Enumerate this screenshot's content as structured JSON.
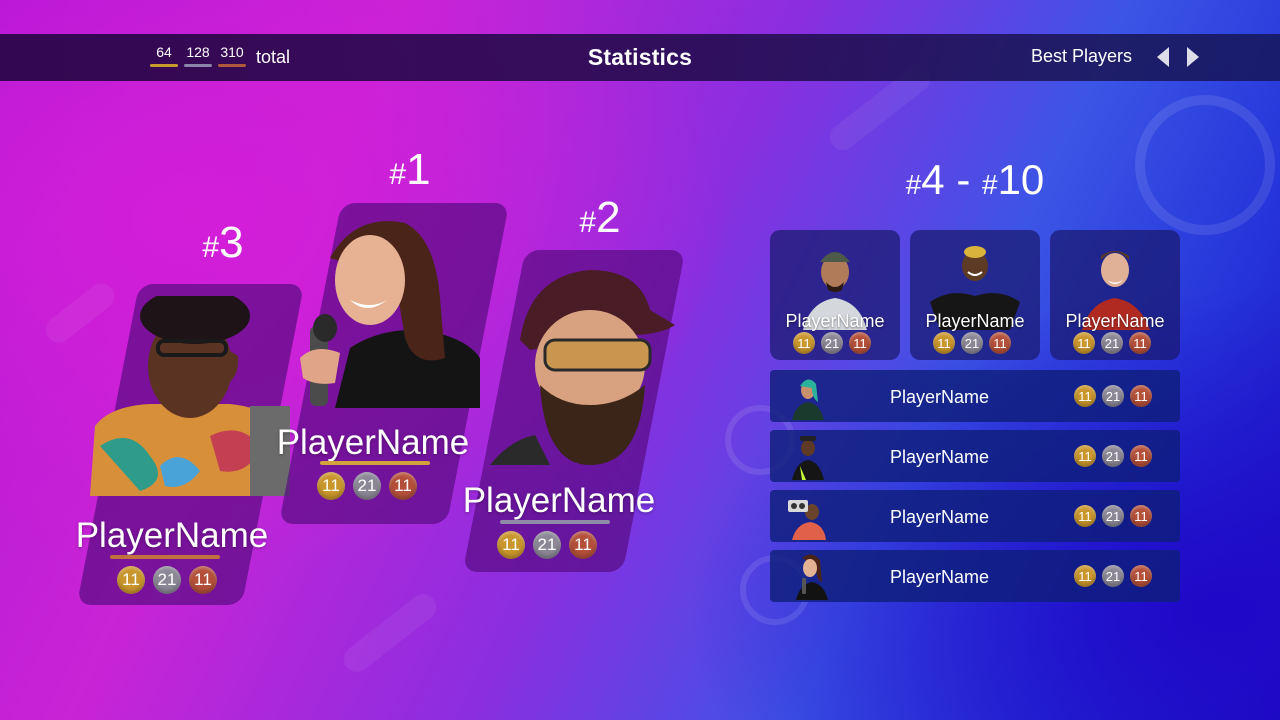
{
  "header": {
    "totals": [
      {
        "value": "64",
        "color": "#c99a2e"
      },
      {
        "value": "128",
        "color": "#8a84a8"
      },
      {
        "value": "310",
        "color": "#b05a3c"
      }
    ],
    "total_label": "total",
    "title": "Statistics",
    "category": "Best Players"
  },
  "medal_colors": {
    "gold": "#c9962c",
    "silver": "#8b8796",
    "bronze": "#b4503a"
  },
  "podium": [
    {
      "rank_hash": "#",
      "rank_number": "1",
      "name": "PlayerName",
      "gold": "11",
      "silver": "21",
      "bronze": "11",
      "underline": "#d3a33b"
    },
    {
      "rank_hash": "#",
      "rank_number": "2",
      "name": "PlayerName",
      "gold": "11",
      "silver": "21",
      "bronze": "11",
      "underline": "#8f8aa8"
    },
    {
      "rank_hash": "#",
      "rank_number": "3",
      "name": "PlayerName",
      "gold": "11",
      "silver": "21",
      "bronze": "11",
      "underline": "#c2703e"
    }
  ],
  "others": {
    "range_hash_a": "#",
    "range_from": "4",
    "range_sep": " - ",
    "range_hash_b": "#",
    "range_to": "10",
    "tiles": [
      {
        "name": "PlayerName",
        "gold": "11",
        "silver": "21",
        "bronze": "11"
      },
      {
        "name": "PlayerName",
        "gold": "11",
        "silver": "21",
        "bronze": "11"
      },
      {
        "name": "PlayerName",
        "gold": "11",
        "silver": "21",
        "bronze": "11"
      }
    ],
    "rows": [
      {
        "name": "PlayerName",
        "gold": "11",
        "silver": "21",
        "bronze": "11"
      },
      {
        "name": "PlayerName",
        "gold": "11",
        "silver": "21",
        "bronze": "11"
      },
      {
        "name": "PlayerName",
        "gold": "11",
        "silver": "21",
        "bronze": "11"
      },
      {
        "name": "PlayerName",
        "gold": "11",
        "silver": "21",
        "bronze": "11"
      }
    ]
  }
}
